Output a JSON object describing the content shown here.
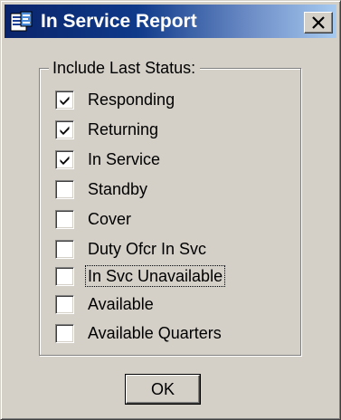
{
  "window": {
    "title": "In Service Report",
    "icon": "report-window-icon",
    "close_icon": "close-icon"
  },
  "group": {
    "label": "Include Last Status:",
    "items": [
      {
        "label": "Responding",
        "checked": true
      },
      {
        "label": "Returning",
        "checked": true
      },
      {
        "label": "In Service",
        "checked": true
      },
      {
        "label": "Standby",
        "checked": false
      },
      {
        "label": "Cover",
        "checked": false
      },
      {
        "label": "Duty Ofcr In Svc",
        "checked": false
      },
      {
        "label": "In Svc Unavailable",
        "checked": false,
        "focused": true
      },
      {
        "label": "Available",
        "checked": false
      },
      {
        "label": "Available Quarters",
        "checked": false
      }
    ]
  },
  "buttons": {
    "ok_label": "OK"
  },
  "colors": {
    "face": "#d4d0c8",
    "title_start": "#0a246a",
    "title_end": "#a6caf0"
  }
}
